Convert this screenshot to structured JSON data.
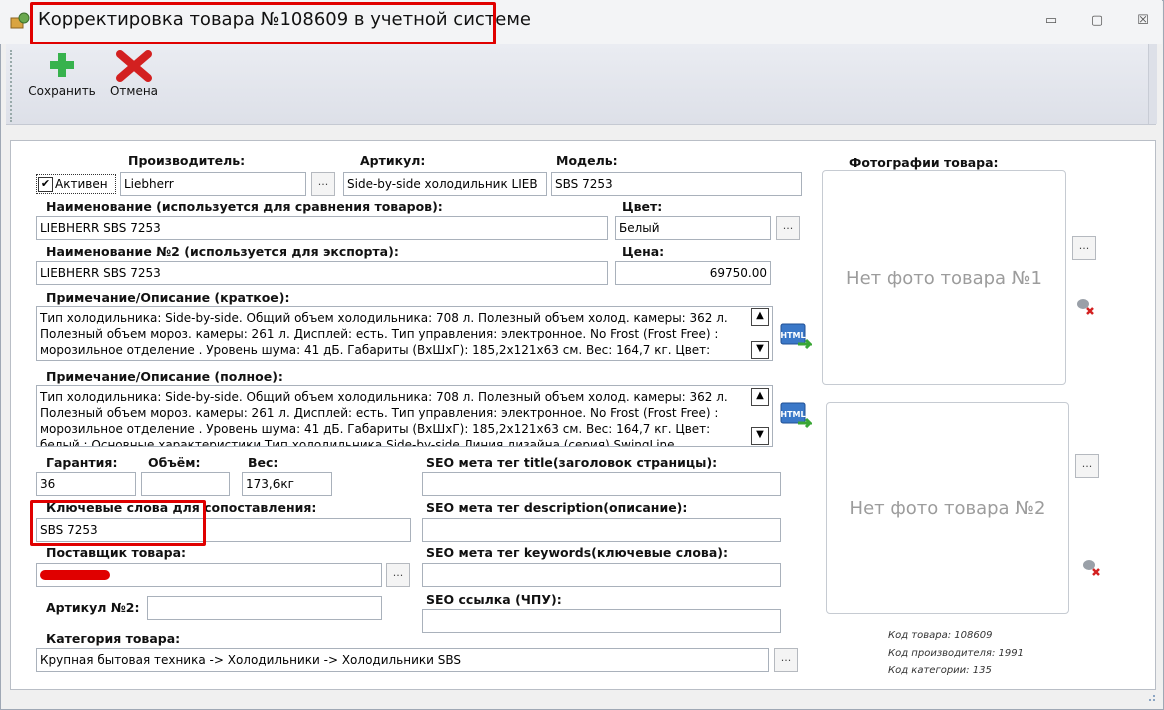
{
  "window": {
    "title": "Корректировка товара №108609 в учетной системе",
    "controls": {
      "minimize": "▭",
      "maximize": "▢",
      "close": "☒"
    }
  },
  "toolbar": {
    "save_label": "Сохранить",
    "cancel_label": "Отмена"
  },
  "form": {
    "active_label": "Активен",
    "manufacturer": {
      "label": "Производитель:",
      "value": "Liebherr",
      "button": "..."
    },
    "article": {
      "label": "Артикул:",
      "value": "Side-by-side холодильник LIEB"
    },
    "model": {
      "label": "Модель:",
      "value": "SBS 7253"
    },
    "name": {
      "label": "Наименование (используется для сравнения товаров):",
      "value": "LIEBHERR SBS 7253"
    },
    "color": {
      "label": "Цвет:",
      "value": "Белый",
      "button": "..."
    },
    "name2": {
      "label": "Наименование №2 (используется для экспорта):",
      "value": "LIEBHERR SBS 7253"
    },
    "price": {
      "label": "Цена:",
      "value": "69750.00"
    },
    "short_desc": {
      "label": "Примечание/Описание (краткое):",
      "lines": [
        "Тип холодильника: Side-by-side. Общий объем холодильника: 708 л. Полезный объем холод. камеры: 362 л.",
        "Полезный объем мороз. камеры: 261 л. Дисплей: есть. Тип управления: электронное. No Frost (Frost Free) :",
        "морозильное отделение . Уровень шума: 41 дБ. Габариты (ВхШхГ): 185,2х121х63 см. Вес: 164,7 кг. Цвет:"
      ]
    },
    "full_desc": {
      "label": "Примечание/Описание (полное):",
      "lines": [
        "Тип холодильника: Side-by-side. Общий объем холодильника: 708 л. Полезный объем холод. камеры: 362 л.",
        "Полезный объем мороз. камеры: 261 л. Дисплей: есть. Тип управления: электронное. No Frost (Frost Free) :",
        "морозильное отделение . Уровень шума: 41 дБ. Габариты (ВхШхГ): 185,2х121х63 см. Вес: 164,7 кг. Цвет:",
        "белый ; Основные характеристики Тип холодильника Side-by-side Линия дизайна (серия) SwingLine"
      ]
    },
    "html_icon_label": "HTML",
    "warranty": {
      "label": "Гарантия:",
      "value": "36"
    },
    "volume": {
      "label": "Объём:",
      "value": ""
    },
    "weight": {
      "label": "Вес:",
      "value": "173,6кг"
    },
    "keywords_match": {
      "label": "Ключевые слова для сопоставления:",
      "value": "SBS 7253"
    },
    "supplier": {
      "label": "Поставщик товара:",
      "button": "..."
    },
    "article2": {
      "label": "Артикул №2:",
      "value": ""
    },
    "category": {
      "label": "Категория товара:",
      "value": "Крупная бытовая техника -> Холодильники -> Холодильники SBS",
      "button": "..."
    },
    "seo_title": {
      "label": "SEO мета тег title(заголовок страницы):",
      "value": ""
    },
    "seo_description": {
      "label": "SEO мета тег description(описание):",
      "value": ""
    },
    "seo_keywords": {
      "label": "SEO мета тег keywords(ключевые слова):",
      "value": ""
    },
    "seo_link": {
      "label": "SEO ссылка (ЧПУ):",
      "value": ""
    }
  },
  "photos": {
    "label": "Фотографии товара:",
    "photo1": "Нет фото товара №1",
    "photo2": "Нет фото товара №2",
    "button": "..."
  },
  "meta": {
    "product_code": "Код товара: 108609",
    "manufacturer_code": "Код производителя: 1991",
    "category_code": "Код категории: 135"
  },
  "colors": {
    "highlight": "#e00000",
    "save_icon": "#37b24d",
    "cancel_icon": "#d32020"
  }
}
